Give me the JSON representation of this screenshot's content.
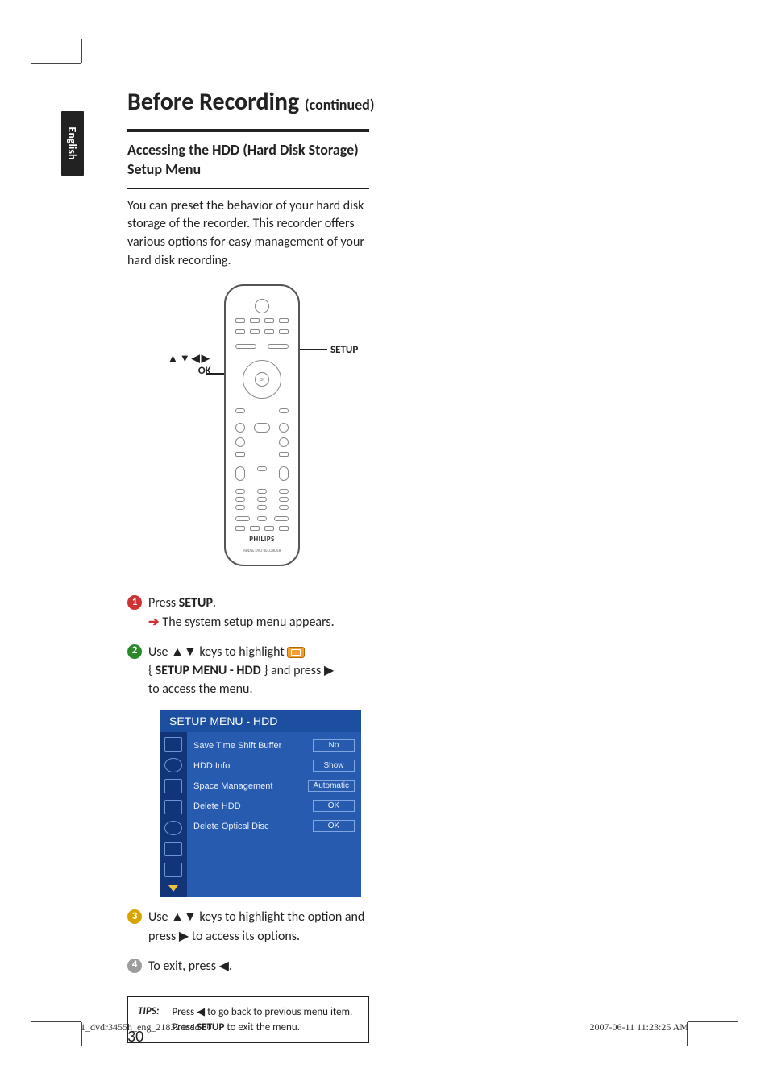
{
  "lang_tab": "English",
  "title": {
    "main": "Before Recording ",
    "sub": "(continued)"
  },
  "section_heading": "Accessing the  HDD (Hard Disk Storage) Setup Menu",
  "intro_para": "You can preset the behavior of your hard disk storage of the recorder.  This recorder offers various options for easy management of your hard disk recording.",
  "remote": {
    "left_arrows": "▲▼◀▶",
    "left_ok": "OK",
    "right": "SETUP",
    "brand": "PHILIPS",
    "sub": "HDD & DVD RECORDER",
    "ok_center": "OK"
  },
  "steps": {
    "s1_a": "Press ",
    "s1_b": "SETUP",
    "s1_c": ".",
    "s1_result": "The system setup menu appears.",
    "s2_a": "Use ",
    "s2_arrows": "▲▼",
    "s2_b": " keys to highlight ",
    "s2_menu_open": "{ ",
    "s2_menu_label": "SETUP MENU - HDD",
    "s2_menu_close": " } and press ",
    "s2_right": "▶",
    "s2_tail": "to access the menu.",
    "s3_a": "Use ",
    "s3_arrows": "▲▼",
    "s3_b": " keys to highlight the option and press ",
    "s3_right": "▶",
    "s3_c": " to access its options.",
    "s4_a": "To exit, press ",
    "s4_left": "◀",
    "s4_b": "."
  },
  "setup_menu": {
    "title": "SETUP MENU - HDD",
    "rows": [
      {
        "label": "Save Time Shift Buffer",
        "value": "No"
      },
      {
        "label": "HDD Info",
        "value": "Show"
      },
      {
        "label": "Space Management",
        "value": "Automatic"
      },
      {
        "label": "Delete HDD",
        "value": "OK"
      },
      {
        "label": "Delete Optical Disc",
        "value": "OK"
      }
    ]
  },
  "tips": {
    "label": "TIPS:",
    "l1_a": "Press ",
    "l1_left": "◀",
    "l1_b": " to go back to previous menu item.",
    "l2_a": "Press ",
    "l2_bold": "SETUP",
    "l2_b": " to exit the menu."
  },
  "page_number": "30",
  "footer": {
    "left": "1_dvdr3455h_eng_21832.indd   30",
    "right": "2007-06-11   11:23:25 AM"
  }
}
